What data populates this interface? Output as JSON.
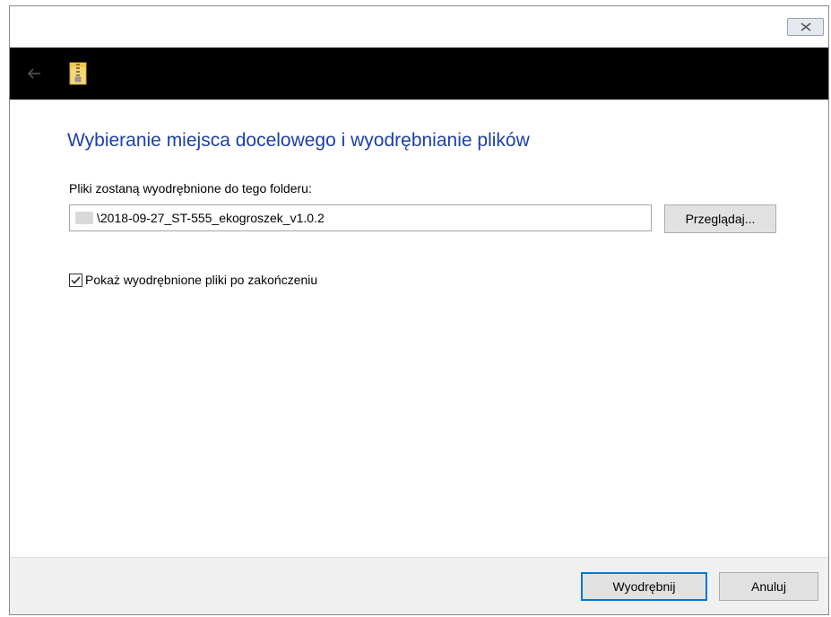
{
  "titlebar": {
    "close_icon": "close-icon"
  },
  "navbar": {
    "back_icon": "back-arrow-icon",
    "app_icon": "zip-folder-icon"
  },
  "main": {
    "heading": "Wybieranie miejsca docelowego i wyodrębnianie plików",
    "path_label": "Pliki zostaną wyodrębnione do tego folderu:",
    "path_value": "\\2018-09-27_ST-555_ekogroszek_v1.0.2",
    "browse_label": "Przeglądaj...",
    "show_files_label": "Pokaż wyodrębnione pliki po zakończeniu",
    "show_files_checked": true
  },
  "footer": {
    "extract_label": "Wyodrębnij",
    "cancel_label": "Anuluj"
  },
  "colors": {
    "heading": "#1c3fa8",
    "navbar": "#000000",
    "footer": "#f0f0f0",
    "focus_border": "#0078d7"
  }
}
